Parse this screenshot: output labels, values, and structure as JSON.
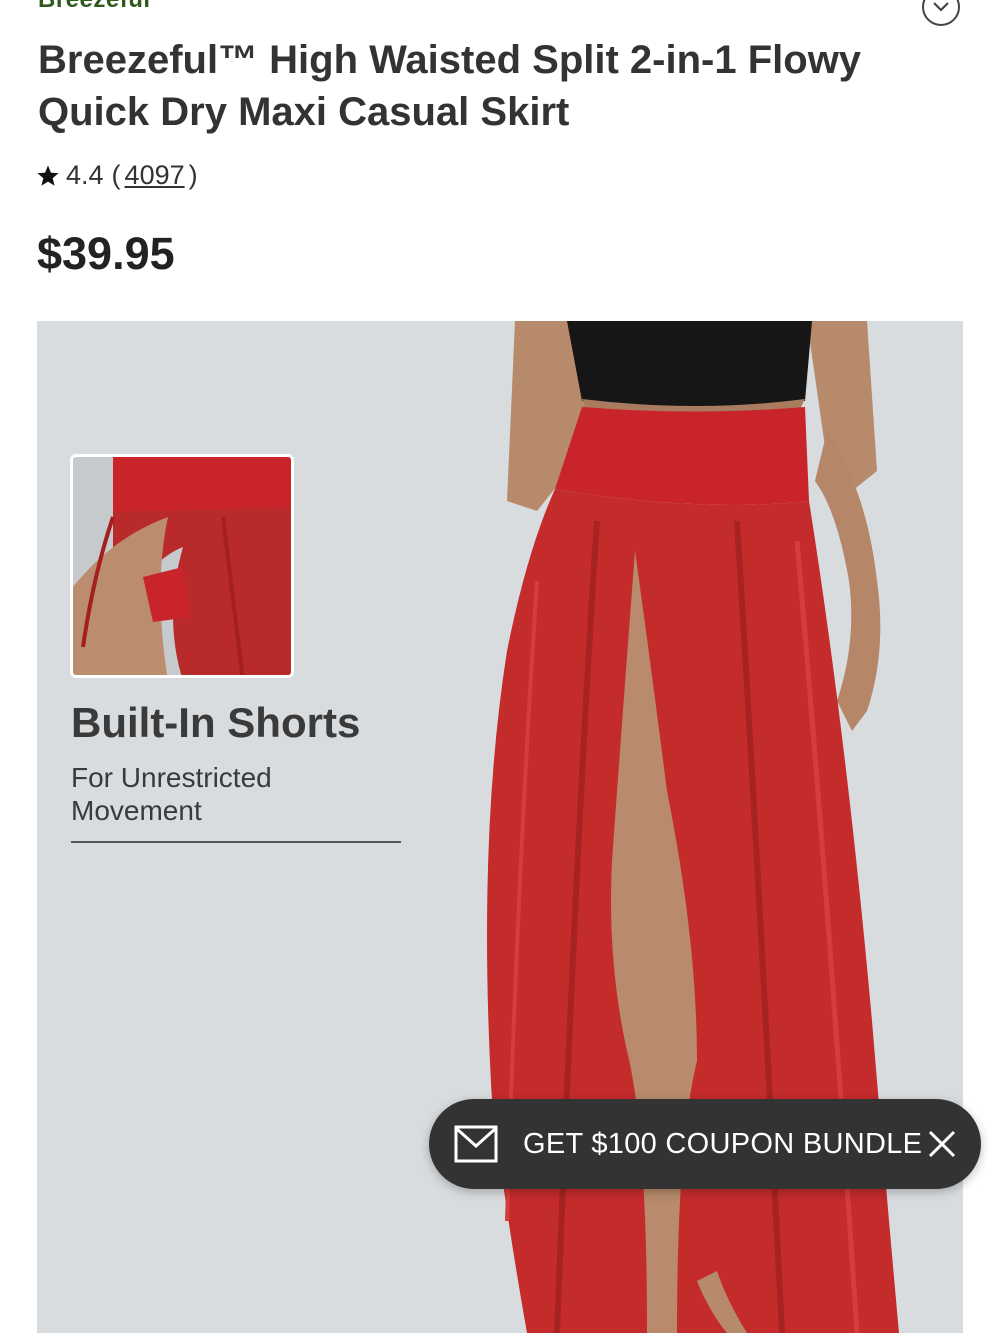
{
  "header": {
    "brand": "Breezeful",
    "collapse_icon": "chevron-down-icon"
  },
  "product": {
    "title": "Breezeful™ High Waisted Split 2-in-1 Flowy Quick Dry Maxi Casual Skirt",
    "rating": "4.4",
    "review_count": "4097",
    "rating_open": "(",
    "rating_close": ")",
    "rating_icon": "star-icon",
    "price": "$39.95"
  },
  "hero": {
    "feature_title": "Built-In Shorts",
    "feature_subtitle": "For Unrestricted Movement",
    "background_color": "#d9dcdf",
    "skirt_color": "#c42b2b"
  },
  "coupon_banner": {
    "label": "GET $100 COUPON BUNDLE",
    "mail_icon": "mail-icon",
    "close_icon": "close-icon",
    "background_color": "#333333"
  }
}
